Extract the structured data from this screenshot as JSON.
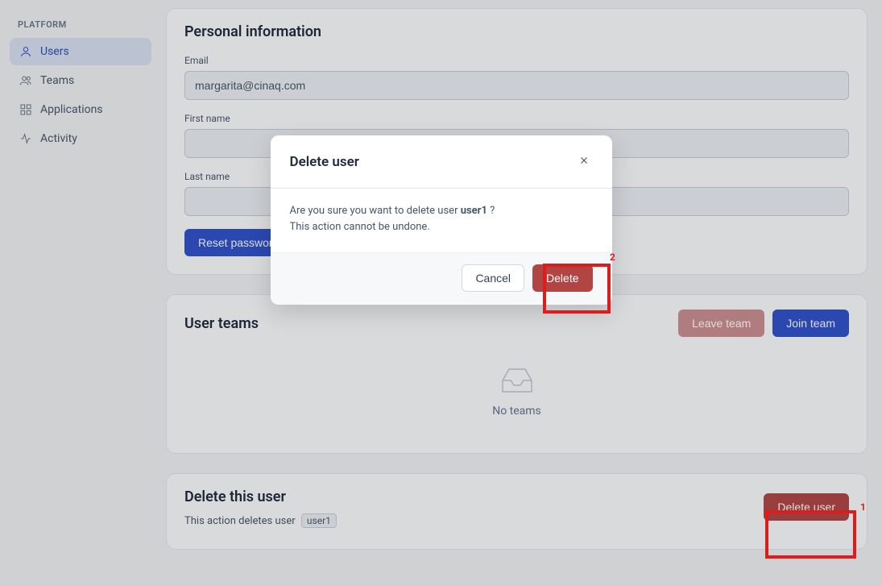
{
  "sidebar": {
    "header": "PLATFORM",
    "items": [
      {
        "label": "Users"
      },
      {
        "label": "Teams"
      },
      {
        "label": "Applications"
      },
      {
        "label": "Activity"
      }
    ]
  },
  "personal": {
    "title": "Personal information",
    "email_label": "Email",
    "email_value": "margarita@cinaq.com",
    "first_name_label": "First name",
    "first_name_value": "",
    "last_name_label": "Last name",
    "last_name_value": "",
    "reset_btn": "Reset password"
  },
  "teams": {
    "title": "User teams",
    "leave_btn": "Leave team",
    "join_btn": "Join team",
    "empty_text": "No teams"
  },
  "delete_section": {
    "title": "Delete this user",
    "desc_prefix": "This action deletes user",
    "user_chip": "user1",
    "delete_btn": "Delete user"
  },
  "modal": {
    "title": "Delete user",
    "body_prefix": "Are you sure you want to delete user ",
    "body_user": "user1",
    "body_suffix": " ?",
    "body_line2": "This action cannot be undone.",
    "cancel_btn": "Cancel",
    "delete_btn": "Delete"
  },
  "annotations": {
    "a1": "1",
    "a2": "2"
  }
}
